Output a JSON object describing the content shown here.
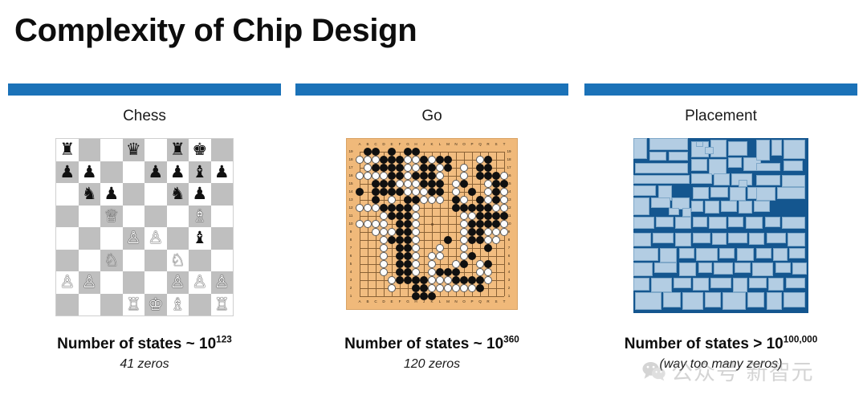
{
  "slide": {
    "title": "Complexity of Chip Design",
    "accent_color": "#1b72b8"
  },
  "columns": [
    {
      "label": "Chess",
      "figure": "chess-board",
      "caption_prefix": "Number of states ~ 10",
      "caption_exponent": "123",
      "caption_sub": "41 zeros"
    },
    {
      "label": "Go",
      "figure": "go-board",
      "caption_prefix": "Number of states ~ 10",
      "caption_exponent": "360",
      "caption_sub": "120 zeros"
    },
    {
      "label": "Placement",
      "figure": "chip-placement",
      "caption_prefix": "Number of states > 10",
      "caption_exponent": "100,000",
      "caption_sub": "(way too many zeros)"
    }
  ],
  "chess": {
    "light_square_color": "#ffffff",
    "dark_square_color": "#bfbfbf",
    "position": [
      [
        "r",
        "",
        "",
        "q",
        "",
        "r",
        "k",
        ""
      ],
      [
        "p",
        "p",
        "",
        "",
        "p",
        "p",
        "b",
        "p"
      ],
      [
        "",
        "n",
        "p",
        "",
        "",
        "n",
        "p",
        ""
      ],
      [
        "",
        "",
        "Q",
        "",
        "",
        "",
        "B",
        ""
      ],
      [
        "",
        "",
        "",
        "P",
        "P",
        "",
        "b",
        ""
      ],
      [
        "",
        "",
        "N",
        "",
        "",
        "N",
        "",
        ""
      ],
      [
        "P",
        "P",
        "",
        "",
        "",
        "P",
        "P",
        "P"
      ],
      [
        "",
        "",
        "",
        "R",
        "K",
        "B",
        "",
        "R"
      ]
    ],
    "glyphs": {
      "K": "♔",
      "Q": "♕",
      "R": "♖",
      "B": "♗",
      "N": "♘",
      "P": "♙",
      "k": "♚",
      "q": "♛",
      "r": "♜",
      "b": "♝",
      "n": "♞",
      "p": "♟"
    }
  },
  "go": {
    "size": 19,
    "board_color": "#f2bd80",
    "column_labels": [
      "A",
      "B",
      "C",
      "D",
      "E",
      "F",
      "G",
      "H",
      "J",
      "K",
      "L",
      "M",
      "N",
      "O",
      "P",
      "Q",
      "R",
      "S",
      "T"
    ],
    "row_labels": [
      "19",
      "18",
      "17",
      "16",
      "15",
      "14",
      "13",
      "12",
      "11",
      "10",
      "9",
      "8",
      "7",
      "6",
      "5",
      "4",
      "3",
      "2",
      "1"
    ],
    "black_stones": [
      [
        0,
        1
      ],
      [
        0,
        2
      ],
      [
        0,
        4
      ],
      [
        0,
        6
      ],
      [
        0,
        7
      ],
      [
        1,
        3
      ],
      [
        1,
        4
      ],
      [
        1,
        5
      ],
      [
        1,
        8
      ],
      [
        1,
        10
      ],
      [
        1,
        11
      ],
      [
        1,
        16
      ],
      [
        2,
        2
      ],
      [
        2,
        3
      ],
      [
        2,
        4
      ],
      [
        2,
        5
      ],
      [
        2,
        8
      ],
      [
        2,
        9
      ],
      [
        2,
        11
      ],
      [
        2,
        15
      ],
      [
        2,
        16
      ],
      [
        3,
        4
      ],
      [
        3,
        5
      ],
      [
        3,
        7
      ],
      [
        3,
        8
      ],
      [
        3,
        9
      ],
      [
        3,
        15
      ],
      [
        3,
        16
      ],
      [
        3,
        17
      ],
      [
        4,
        2
      ],
      [
        4,
        3
      ],
      [
        4,
        4
      ],
      [
        4,
        8
      ],
      [
        4,
        9
      ],
      [
        4,
        10
      ],
      [
        4,
        13
      ],
      [
        4,
        17
      ],
      [
        4,
        18
      ],
      [
        5,
        0
      ],
      [
        5,
        2
      ],
      [
        5,
        3
      ],
      [
        5,
        4
      ],
      [
        5,
        5
      ],
      [
        5,
        9
      ],
      [
        5,
        10
      ],
      [
        5,
        14
      ],
      [
        5,
        17
      ],
      [
        6,
        2
      ],
      [
        6,
        6
      ],
      [
        6,
        7
      ],
      [
        6,
        12
      ],
      [
        6,
        15
      ],
      [
        6,
        17
      ],
      [
        7,
        3
      ],
      [
        7,
        4
      ],
      [
        7,
        5
      ],
      [
        7,
        6
      ],
      [
        7,
        12
      ],
      [
        7,
        13
      ],
      [
        7,
        14
      ],
      [
        7,
        15
      ],
      [
        7,
        16
      ],
      [
        8,
        4
      ],
      [
        8,
        5
      ],
      [
        8,
        6
      ],
      [
        8,
        15
      ],
      [
        8,
        16
      ],
      [
        8,
        17
      ],
      [
        8,
        18
      ],
      [
        9,
        5
      ],
      [
        9,
        6
      ],
      [
        9,
        14
      ],
      [
        9,
        15
      ],
      [
        9,
        16
      ],
      [
        9,
        17
      ],
      [
        10,
        5
      ],
      [
        10,
        6
      ],
      [
        10,
        14
      ],
      [
        10,
        15
      ],
      [
        11,
        4
      ],
      [
        11,
        5
      ],
      [
        11,
        6
      ],
      [
        11,
        11
      ],
      [
        11,
        14
      ],
      [
        11,
        15
      ],
      [
        12,
        5
      ],
      [
        12,
        6
      ],
      [
        12,
        16
      ],
      [
        13,
        5
      ],
      [
        13,
        6
      ],
      [
        13,
        14
      ],
      [
        14,
        5
      ],
      [
        14,
        6
      ],
      [
        14,
        13
      ],
      [
        14,
        16
      ],
      [
        15,
        5
      ],
      [
        15,
        6
      ],
      [
        15,
        10
      ],
      [
        15,
        11
      ],
      [
        15,
        12
      ],
      [
        16,
        5
      ],
      [
        16,
        6
      ],
      [
        16,
        7
      ],
      [
        16,
        8
      ],
      [
        16,
        12
      ],
      [
        16,
        13
      ],
      [
        16,
        14
      ],
      [
        16,
        15
      ],
      [
        17,
        7
      ],
      [
        17,
        8
      ],
      [
        17,
        15
      ],
      [
        18,
        7
      ],
      [
        18,
        8
      ],
      [
        18,
        9
      ]
    ],
    "white_stones": [
      [
        1,
        0
      ],
      [
        1,
        1
      ],
      [
        1,
        2
      ],
      [
        1,
        6
      ],
      [
        1,
        7
      ],
      [
        1,
        9
      ],
      [
        1,
        15
      ],
      [
        2,
        1
      ],
      [
        2,
        6
      ],
      [
        2,
        7
      ],
      [
        2,
        10
      ],
      [
        2,
        13
      ],
      [
        3,
        0
      ],
      [
        3,
        1
      ],
      [
        3,
        2
      ],
      [
        3,
        3
      ],
      [
        3,
        6
      ],
      [
        3,
        10
      ],
      [
        3,
        13
      ],
      [
        3,
        18
      ],
      [
        4,
        5
      ],
      [
        4,
        6
      ],
      [
        4,
        7
      ],
      [
        4,
        12
      ],
      [
        4,
        16
      ],
      [
        5,
        6
      ],
      [
        5,
        7
      ],
      [
        5,
        8
      ],
      [
        5,
        12
      ],
      [
        5,
        16
      ],
      [
        5,
        18
      ],
      [
        6,
        4
      ],
      [
        6,
        8
      ],
      [
        6,
        9
      ],
      [
        6,
        10
      ],
      [
        6,
        13
      ],
      [
        6,
        16
      ],
      [
        6,
        18
      ],
      [
        7,
        0
      ],
      [
        7,
        1
      ],
      [
        7,
        2
      ],
      [
        7,
        7
      ],
      [
        7,
        17
      ],
      [
        7,
        18
      ],
      [
        8,
        3
      ],
      [
        8,
        7
      ],
      [
        8,
        13
      ],
      [
        8,
        14
      ],
      [
        9,
        0
      ],
      [
        9,
        1
      ],
      [
        9,
        2
      ],
      [
        9,
        3
      ],
      [
        9,
        7
      ],
      [
        9,
        13
      ],
      [
        9,
        18
      ],
      [
        10,
        2
      ],
      [
        10,
        3
      ],
      [
        10,
        4
      ],
      [
        10,
        7
      ],
      [
        10,
        13
      ],
      [
        10,
        16
      ],
      [
        10,
        17
      ],
      [
        10,
        18
      ],
      [
        11,
        3
      ],
      [
        11,
        7
      ],
      [
        11,
        13
      ],
      [
        11,
        16
      ],
      [
        11,
        17
      ],
      [
        12,
        3
      ],
      [
        12,
        7
      ],
      [
        12,
        10
      ],
      [
        12,
        13
      ],
      [
        13,
        3
      ],
      [
        13,
        7
      ],
      [
        13,
        9
      ],
      [
        13,
        10
      ],
      [
        13,
        13
      ],
      [
        14,
        3
      ],
      [
        14,
        7
      ],
      [
        14,
        9
      ],
      [
        14,
        12
      ],
      [
        14,
        15
      ],
      [
        15,
        3
      ],
      [
        15,
        7
      ],
      [
        15,
        9
      ],
      [
        15,
        15
      ],
      [
        15,
        16
      ],
      [
        16,
        4
      ],
      [
        16,
        9
      ],
      [
        16,
        10
      ],
      [
        16,
        11
      ],
      [
        16,
        16
      ],
      [
        17,
        4
      ],
      [
        17,
        9
      ],
      [
        17,
        10
      ],
      [
        17,
        11
      ],
      [
        17,
        12
      ],
      [
        17,
        13
      ],
      [
        17,
        14
      ]
    ],
    "star_points": [
      [
        3,
        3
      ],
      [
        3,
        9
      ],
      [
        3,
        15
      ],
      [
        9,
        3
      ],
      [
        9,
        9
      ],
      [
        9,
        15
      ],
      [
        15,
        3
      ],
      [
        15,
        9
      ],
      [
        15,
        15
      ]
    ]
  },
  "placement": {
    "background_color": "#14568f",
    "block_color": "#b3cde3",
    "blocks": [
      [
        0,
        0,
        8,
        12
      ],
      [
        9,
        0,
        22,
        7
      ],
      [
        9,
        8,
        10,
        5
      ],
      [
        20,
        8,
        11,
        5
      ],
      [
        1,
        14,
        30,
        6
      ],
      [
        33,
        2,
        10,
        9
      ],
      [
        44,
        1,
        9,
        10
      ],
      [
        54,
        2,
        11,
        8
      ],
      [
        33,
        12,
        9,
        7
      ],
      [
        43,
        12,
        10,
        9
      ],
      [
        54,
        11,
        8,
        6
      ],
      [
        63,
        11,
        10,
        8
      ],
      [
        33,
        20,
        12,
        6
      ],
      [
        46,
        20,
        9,
        7
      ],
      [
        56,
        20,
        12,
        7
      ],
      [
        70,
        1,
        8,
        12
      ],
      [
        79,
        1,
        6,
        9
      ],
      [
        70,
        14,
        14,
        5
      ],
      [
        86,
        1,
        12,
        11
      ],
      [
        86,
        13,
        11,
        6
      ],
      [
        0,
        21,
        32,
        5
      ],
      [
        34,
        28,
        9,
        7
      ],
      [
        44,
        28,
        10,
        6
      ],
      [
        55,
        28,
        9,
        8
      ],
      [
        65,
        28,
        9,
        7
      ],
      [
        0,
        27,
        13,
        6
      ],
      [
        14,
        27,
        8,
        9
      ],
      [
        0,
        34,
        9,
        10
      ],
      [
        10,
        34,
        11,
        6
      ],
      [
        22,
        34,
        10,
        7
      ],
      [
        33,
        36,
        7,
        6
      ],
      [
        41,
        36,
        8,
        7
      ],
      [
        50,
        36,
        9,
        6
      ],
      [
        60,
        36,
        8,
        7
      ],
      [
        69,
        36,
        9,
        6
      ],
      [
        0,
        45,
        12,
        7
      ],
      [
        13,
        45,
        10,
        6
      ],
      [
        24,
        45,
        9,
        7
      ],
      [
        34,
        45,
        8,
        6
      ],
      [
        43,
        45,
        10,
        7
      ],
      [
        54,
        45,
        9,
        6
      ],
      [
        64,
        45,
        10,
        7
      ],
      [
        75,
        45,
        9,
        6
      ],
      [
        85,
        45,
        13,
        7
      ],
      [
        70,
        21,
        14,
        6
      ],
      [
        85,
        21,
        13,
        7
      ],
      [
        70,
        28,
        11,
        8
      ],
      [
        82,
        28,
        16,
        7
      ],
      [
        0,
        54,
        10,
        8
      ],
      [
        11,
        54,
        12,
        6
      ],
      [
        24,
        54,
        9,
        8
      ],
      [
        34,
        54,
        10,
        6
      ],
      [
        45,
        54,
        8,
        7
      ],
      [
        54,
        54,
        11,
        6
      ],
      [
        66,
        54,
        9,
        7
      ],
      [
        76,
        54,
        11,
        6
      ],
      [
        88,
        54,
        10,
        8
      ],
      [
        0,
        63,
        14,
        7
      ],
      [
        15,
        63,
        10,
        8
      ],
      [
        26,
        63,
        9,
        6
      ],
      [
        36,
        63,
        12,
        7
      ],
      [
        49,
        63,
        9,
        6
      ],
      [
        59,
        63,
        10,
        7
      ],
      [
        70,
        63,
        9,
        6
      ],
      [
        80,
        63,
        8,
        7
      ],
      [
        89,
        63,
        9,
        6
      ],
      [
        0,
        71,
        11,
        8
      ],
      [
        12,
        71,
        13,
        6
      ],
      [
        26,
        71,
        10,
        8
      ],
      [
        37,
        71,
        8,
        6
      ],
      [
        46,
        71,
        11,
        7
      ],
      [
        58,
        71,
        9,
        6
      ],
      [
        68,
        71,
        12,
        8
      ],
      [
        81,
        71,
        9,
        6
      ],
      [
        91,
        71,
        8,
        7
      ],
      [
        0,
        80,
        9,
        7
      ],
      [
        10,
        80,
        12,
        8
      ],
      [
        23,
        80,
        10,
        6
      ],
      [
        34,
        80,
        9,
        7
      ],
      [
        44,
        80,
        12,
        6
      ],
      [
        57,
        80,
        8,
        8
      ],
      [
        66,
        80,
        10,
        6
      ],
      [
        77,
        80,
        9,
        7
      ],
      [
        87,
        80,
        11,
        6
      ],
      [
        1,
        88,
        15,
        10
      ],
      [
        17,
        88,
        10,
        9
      ],
      [
        28,
        88,
        12,
        10
      ],
      [
        41,
        88,
        9,
        9
      ],
      [
        51,
        88,
        13,
        10
      ],
      [
        65,
        88,
        10,
        9
      ],
      [
        76,
        88,
        9,
        10
      ],
      [
        86,
        88,
        12,
        9
      ],
      [
        36,
        2,
        4,
        3
      ],
      [
        41,
        5,
        5,
        4
      ],
      [
        20,
        40,
        6,
        4
      ],
      [
        28,
        40,
        5,
        5
      ],
      [
        60,
        24,
        5,
        4
      ]
    ]
  },
  "watermark": {
    "text": "公众号 新智元",
    "logo": "wechat-icon",
    "color": "#9a9a9a"
  }
}
